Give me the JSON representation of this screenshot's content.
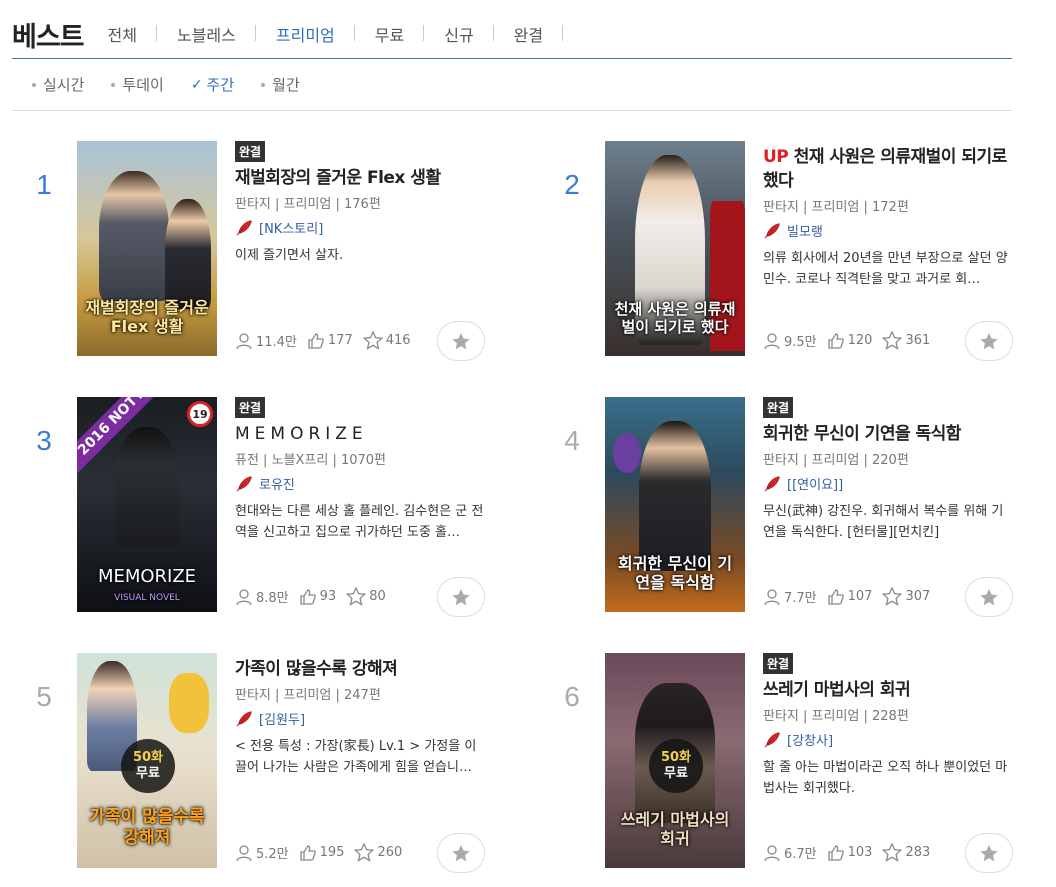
{
  "header": {
    "title": "베스트",
    "tabs": [
      {
        "label": "전체"
      },
      {
        "label": "노블레스"
      },
      {
        "label": "프리미엄",
        "active": true
      },
      {
        "label": "무료"
      },
      {
        "label": "신규"
      },
      {
        "label": "완결"
      }
    ]
  },
  "periods": [
    {
      "label": "실시간"
    },
    {
      "label": "투데이"
    },
    {
      "label": "주간",
      "active": true
    },
    {
      "label": "월간"
    }
  ],
  "items": [
    {
      "rank": "1",
      "tag": "완결",
      "up": "",
      "title": "재벌회장의 즐거운 Flex 생활",
      "meta": "판타지 | 프리미엄 | 176편",
      "author": "[NK스토리]",
      "desc": "이제 즐기면서 살자.",
      "views": "11.4만",
      "likes": "177",
      "stars": "416",
      "cover_text": "재벌회장의 즐거운 Flex 생활"
    },
    {
      "rank": "2",
      "tag": "",
      "up": "UP",
      "title": "천재 사원은 의류재벌이 되기로 했다",
      "meta": "판타지 | 프리미엄 | 172편",
      "author": "빌모랭",
      "desc": "의류 회사에서 20년을 만년 부장으로 살던 양민수. 코로나 직격탄을 맞고 과거로 회…",
      "views": "9.5만",
      "likes": "120",
      "stars": "361",
      "cover_text": "천재 사원은 의류재벌이 되기로 했다"
    },
    {
      "rank": "3",
      "tag": "완결",
      "up": "",
      "title": "MEMORIZE",
      "meta": "퓨전 | 노블X프리 | 1070편",
      "author": "로유진",
      "desc": "현대와는 다른 세상 홀 플레인. 김수현은 군 전역을 신고하고 집으로 귀가하던 도중 홀…",
      "views": "8.8만",
      "likes": "93",
      "stars": "80",
      "cover_text": "MEMORIZE",
      "cover_sub": "VISUAL NOVEL",
      "noty": "2016 NOTY",
      "age": "19"
    },
    {
      "rank": "4",
      "tag": "완결",
      "up": "",
      "title": "회귀한 무신이 기연을 독식함",
      "meta": "판타지 | 프리미엄 | 220편",
      "author": "[[연이요]]",
      "desc": "무신(武神) 강진우. 회귀해서 복수를 위해 기연을 독식한다. [헌터물][먼치킨]",
      "views": "7.7만",
      "likes": "107",
      "stars": "307",
      "cover_text": "회귀한 무신이 기연을 독식함"
    },
    {
      "rank": "5",
      "tag": "",
      "up": "",
      "title": "가족이 많을수록 강해져",
      "meta": "판타지 | 프리미엄 | 247편",
      "author": "[김원두]",
      "desc": "< 전용 특성 : 가장(家長) Lv.1 > 가정을 이끌어 나가는 사람은 가족에게 힘을 얻습니…",
      "views": "5.2만",
      "likes": "195",
      "stars": "260",
      "cover_text": "가족이 많을수록 강해져",
      "free_num": "50화",
      "free_label": "무료"
    },
    {
      "rank": "6",
      "tag": "완결",
      "up": "",
      "title": "쓰레기 마법사의 회귀",
      "meta": "판타지 | 프리미엄 | 228편",
      "author": "[강창사]",
      "desc": "할 줄 아는 마법이라곤 오직 하나 뿐이었던 마법사는 회귀했다.",
      "views": "6.7만",
      "likes": "103",
      "stars": "283",
      "cover_text": "쓰레기 마법사의 회귀",
      "free_num": "50화",
      "free_label": "무료"
    }
  ],
  "colors": {
    "accent": "#2f6fc1",
    "rank_top": "#3a7bd5",
    "rank_other": "#aaaaaa",
    "up": "#e02020",
    "tag_bg": "#333333"
  }
}
